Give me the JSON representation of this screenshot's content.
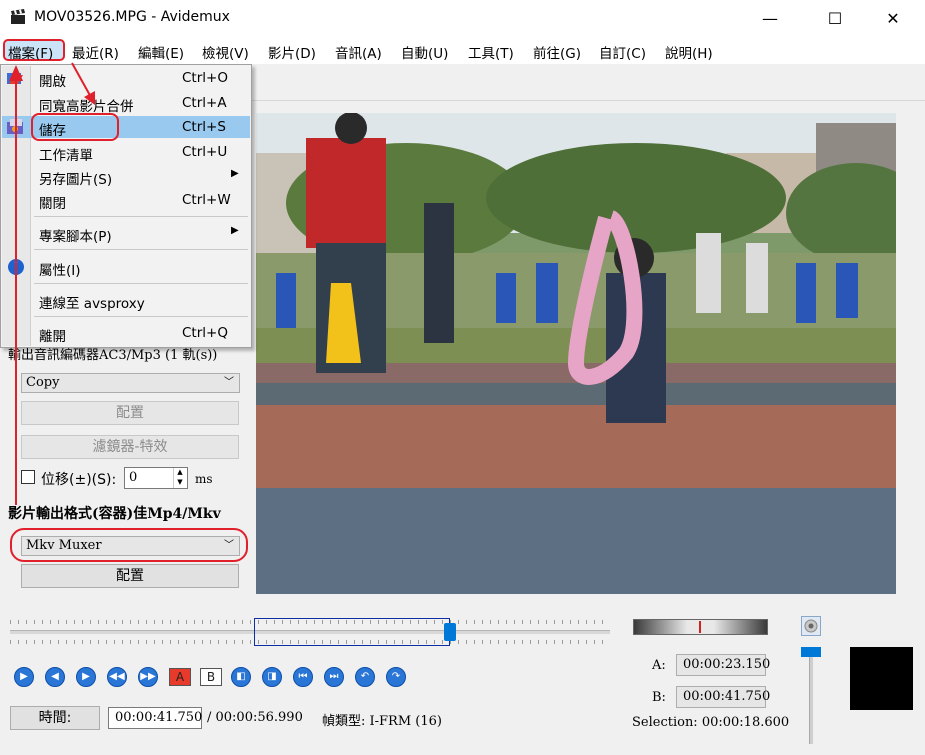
{
  "window": {
    "title": "MOV03526.MPG - Avidemux",
    "minimize": "—",
    "maximize": "☐",
    "close": "✕"
  },
  "menubar": [
    "檔案(F)",
    "最近(R)",
    "編輯(E)",
    "檢視(V)",
    "影片(D)",
    "音訊(A)",
    "自動(U)",
    "工具(T)",
    "前往(G)",
    "自訂(C)",
    "說明(H)"
  ],
  "file_menu": {
    "open": {
      "label": "開啟",
      "shortcut": "Ctrl+O"
    },
    "append": {
      "label": "同寬高影片合併",
      "shortcut": "Ctrl+A"
    },
    "save": {
      "label": "儲存",
      "shortcut": "Ctrl+S"
    },
    "queue": {
      "label": "工作清單",
      "shortcut": "Ctrl+U"
    },
    "save_image": {
      "label": "另存圖片(S)"
    },
    "close": {
      "label": "關閉",
      "shortcut": "Ctrl+W"
    },
    "project": {
      "label": "專案腳本(P)"
    },
    "properties": {
      "label": "屬性(I)"
    },
    "connect": {
      "label": "連線至 avsproxy"
    },
    "quit": {
      "label": "離開",
      "shortcut": "Ctrl+Q"
    }
  },
  "left_panel": {
    "audio_heading": "輸出音訊編碼器AC3/Mp3 (1 軌(s))",
    "audio_codec": "Copy",
    "audio_configure": "配置",
    "audio_filters": "濾鏡器-特效",
    "shift_label": "位移(±)(S):",
    "shift_value": "0",
    "shift_unit": "ms",
    "container_heading": "影片輸出格式(容器)佳Mp4/Mkv",
    "container_value": "Mkv Muxer",
    "container_configure": "配置"
  },
  "status": {
    "time_button": "時間:",
    "current_time": "00:00:41.750",
    "total_time": "/ 00:00:56.990",
    "frame_type": "幀類型: I-FRM (16)",
    "marker_a_label": "A:",
    "marker_a": "00:00:23.150",
    "marker_b_label": "B:",
    "marker_b": "00:00:41.750",
    "selection": "Selection: 00:00:18.600"
  },
  "playback_position": 0.7326,
  "selection_range": [
    0.4062,
    0.7326
  ],
  "colors": {
    "highlight": "#99c9ef",
    "accent": "#0078d7",
    "annotation": "#e0202a"
  }
}
